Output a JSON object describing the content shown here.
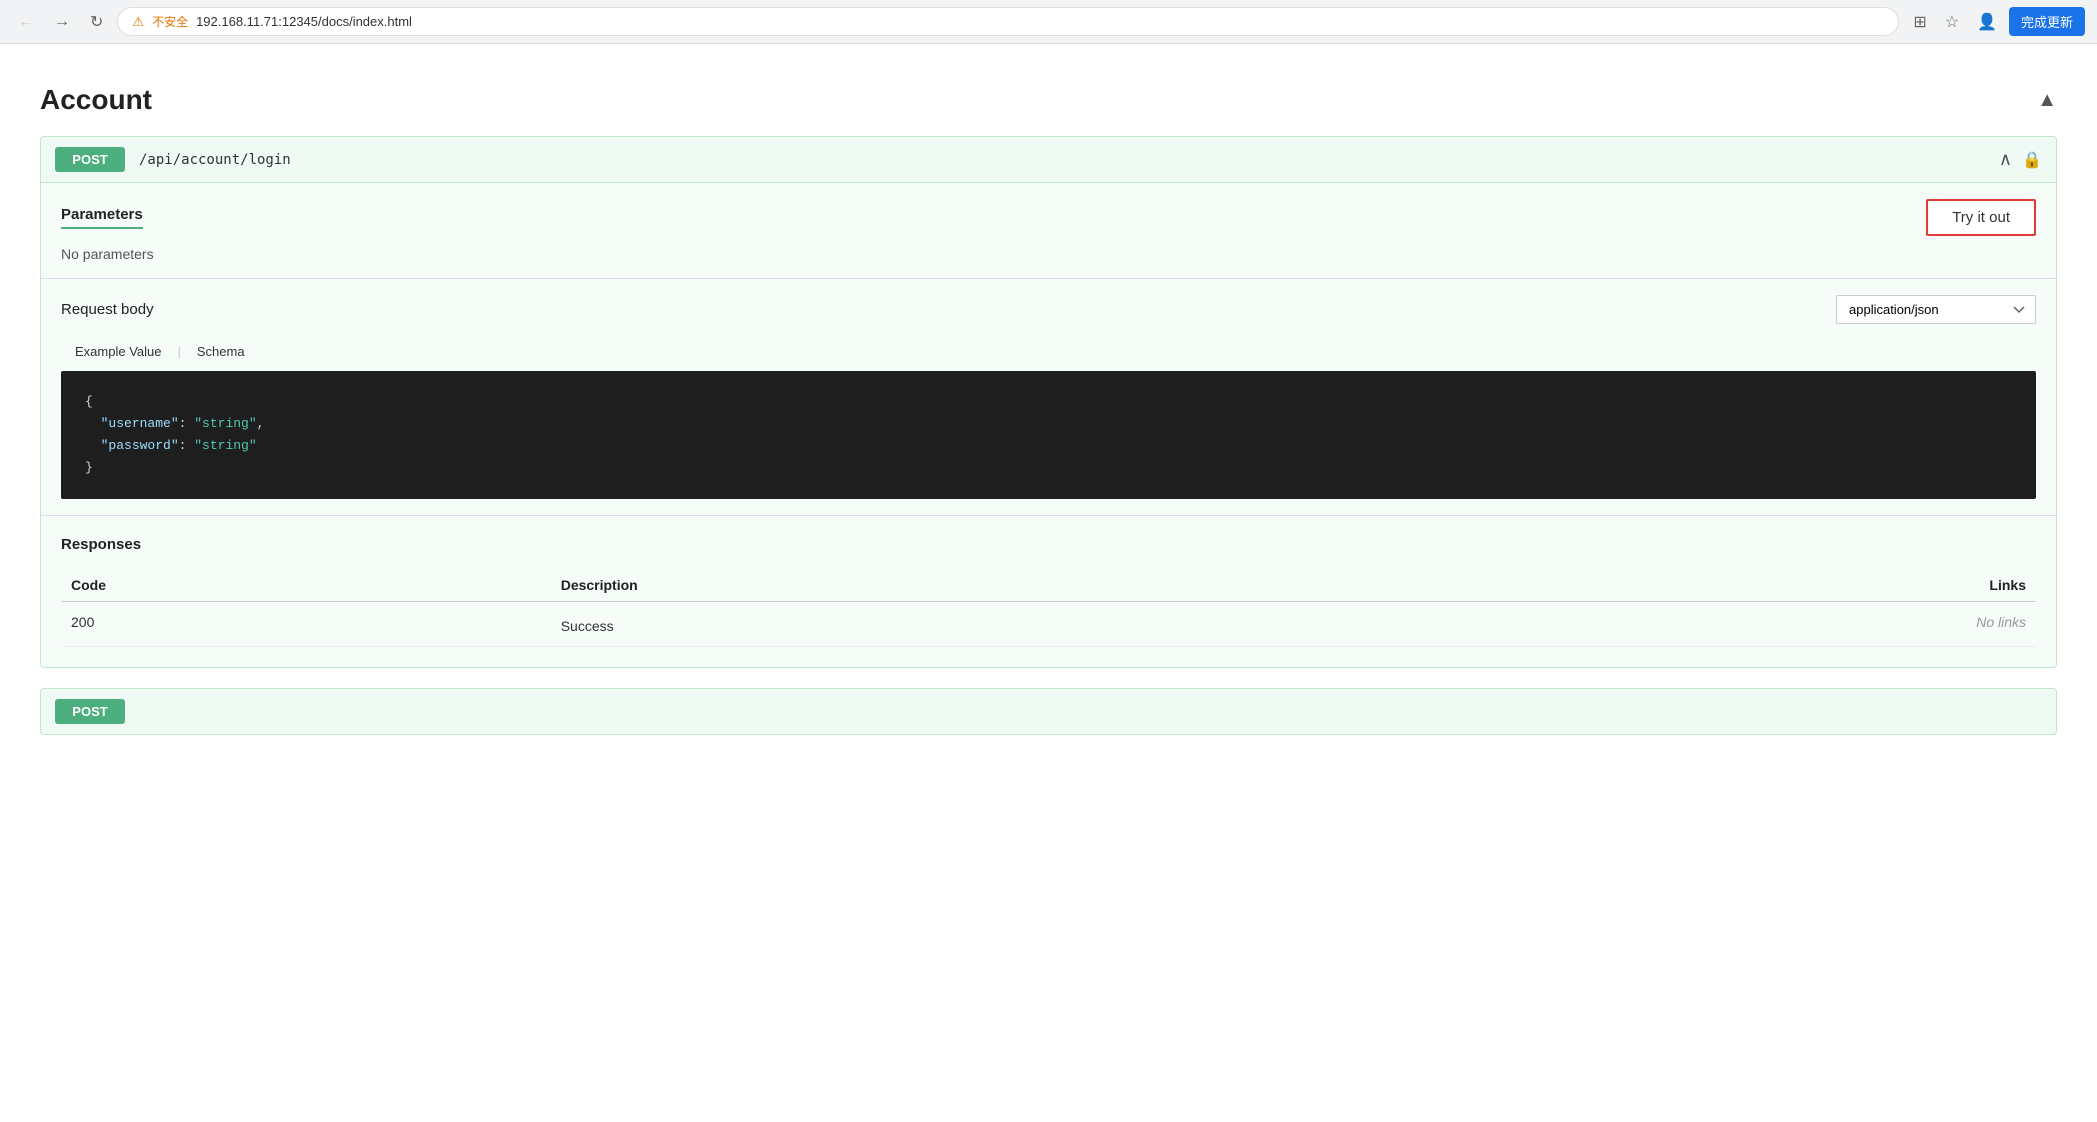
{
  "browser": {
    "url": "192.168.11.71:12345/docs/index.html",
    "insecure_label": "不安全",
    "complete_btn_label": "完成更新"
  },
  "page": {
    "section_title": "Account",
    "collapse_icon": "▲"
  },
  "endpoint": {
    "method": "POST",
    "path": "/api/account/login",
    "toggle_icon": "∧",
    "lock_icon": "🔒",
    "parameters": {
      "title": "Parameters",
      "try_it_out_label": "Try it out",
      "no_params_text": "No parameters"
    },
    "request_body": {
      "title": "Request body",
      "content_type": "application/json",
      "example_tab_label": "Example Value",
      "schema_tab_label": "Schema",
      "code": "{\n  \"username\": \"string\",\n  \"password\": \"string\"\n}"
    },
    "responses": {
      "title": "Responses",
      "col_code": "Code",
      "col_description": "Description",
      "col_links": "Links",
      "rows": [
        {
          "code": "200",
          "description": "Success",
          "links": "No links"
        }
      ]
    }
  }
}
